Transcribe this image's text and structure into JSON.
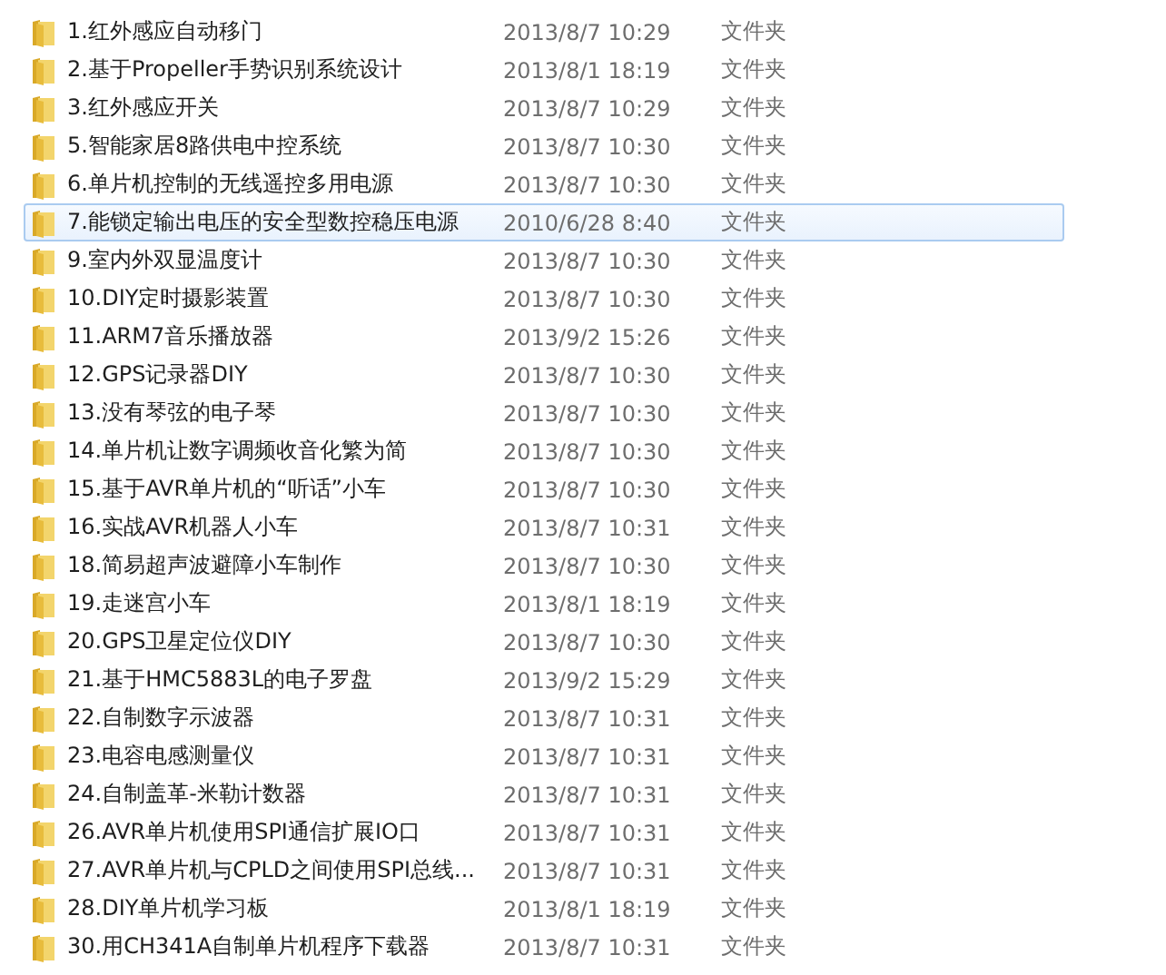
{
  "files": [
    {
      "name": "1.红外感应自动移门",
      "modified": "2013/8/7 10:29",
      "type": "文件夹",
      "selected": false
    },
    {
      "name": "2.基于Propeller手势识别系统设计",
      "modified": "2013/8/1 18:19",
      "type": "文件夹",
      "selected": false
    },
    {
      "name": "3.红外感应开关",
      "modified": "2013/8/7 10:29",
      "type": "文件夹",
      "selected": false
    },
    {
      "name": "5.智能家居8路供电中控系统",
      "modified": "2013/8/7 10:30",
      "type": "文件夹",
      "selected": false
    },
    {
      "name": "6.单片机控制的无线遥控多用电源",
      "modified": "2013/8/7 10:30",
      "type": "文件夹",
      "selected": false
    },
    {
      "name": "7.能锁定输出电压的安全型数控稳压电源",
      "modified": "2010/6/28 8:40",
      "type": "文件夹",
      "selected": true
    },
    {
      "name": "9.室内外双显温度计",
      "modified": "2013/8/7 10:30",
      "type": "文件夹",
      "selected": false
    },
    {
      "name": "10.DIY定时摄影装置",
      "modified": "2013/8/7 10:30",
      "type": "文件夹",
      "selected": false
    },
    {
      "name": "11.ARM7音乐播放器",
      "modified": "2013/9/2 15:26",
      "type": "文件夹",
      "selected": false
    },
    {
      "name": "12.GPS记录器DIY",
      "modified": "2013/8/7 10:30",
      "type": "文件夹",
      "selected": false
    },
    {
      "name": "13.没有琴弦的电子琴",
      "modified": "2013/8/7 10:30",
      "type": "文件夹",
      "selected": false
    },
    {
      "name": "14.单片机让数字调频收音化繁为简",
      "modified": "2013/8/7 10:30",
      "type": "文件夹",
      "selected": false
    },
    {
      "name": "15.基于AVR单片机的“听话”小车",
      "modified": "2013/8/7 10:30",
      "type": "文件夹",
      "selected": false
    },
    {
      "name": "16.实战AVR机器人小车",
      "modified": "2013/8/7 10:31",
      "type": "文件夹",
      "selected": false
    },
    {
      "name": "18.简易超声波避障小车制作",
      "modified": "2013/8/7 10:30",
      "type": "文件夹",
      "selected": false
    },
    {
      "name": "19.走迷宫小车",
      "modified": "2013/8/1 18:19",
      "type": "文件夹",
      "selected": false
    },
    {
      "name": "20.GPS卫星定位仪DIY",
      "modified": "2013/8/7 10:30",
      "type": "文件夹",
      "selected": false
    },
    {
      "name": "21.基于HMC5883L的电子罗盘",
      "modified": "2013/9/2 15:29",
      "type": "文件夹",
      "selected": false
    },
    {
      "name": "22.自制数字示波器",
      "modified": "2013/8/7 10:31",
      "type": "文件夹",
      "selected": false
    },
    {
      "name": "23.电容电感测量仪",
      "modified": "2013/8/7 10:31",
      "type": "文件夹",
      "selected": false
    },
    {
      "name": "24.自制盖革-米勒计数器",
      "modified": "2013/8/7 10:31",
      "type": "文件夹",
      "selected": false
    },
    {
      "name": "26.AVR单片机使用SPI通信扩展IO口",
      "modified": "2013/8/7 10:31",
      "type": "文件夹",
      "selected": false
    },
    {
      "name": "27.AVR单片机与CPLD之间使用SPI总线...",
      "modified": "2013/8/7 10:31",
      "type": "文件夹",
      "selected": false
    },
    {
      "name": "28.DIY单片机学习板",
      "modified": "2013/8/1 18:19",
      "type": "文件夹",
      "selected": false
    },
    {
      "name": "30.用CH341A自制单片机程序下载器",
      "modified": "2013/8/7 10:31",
      "type": "文件夹",
      "selected": false
    }
  ]
}
